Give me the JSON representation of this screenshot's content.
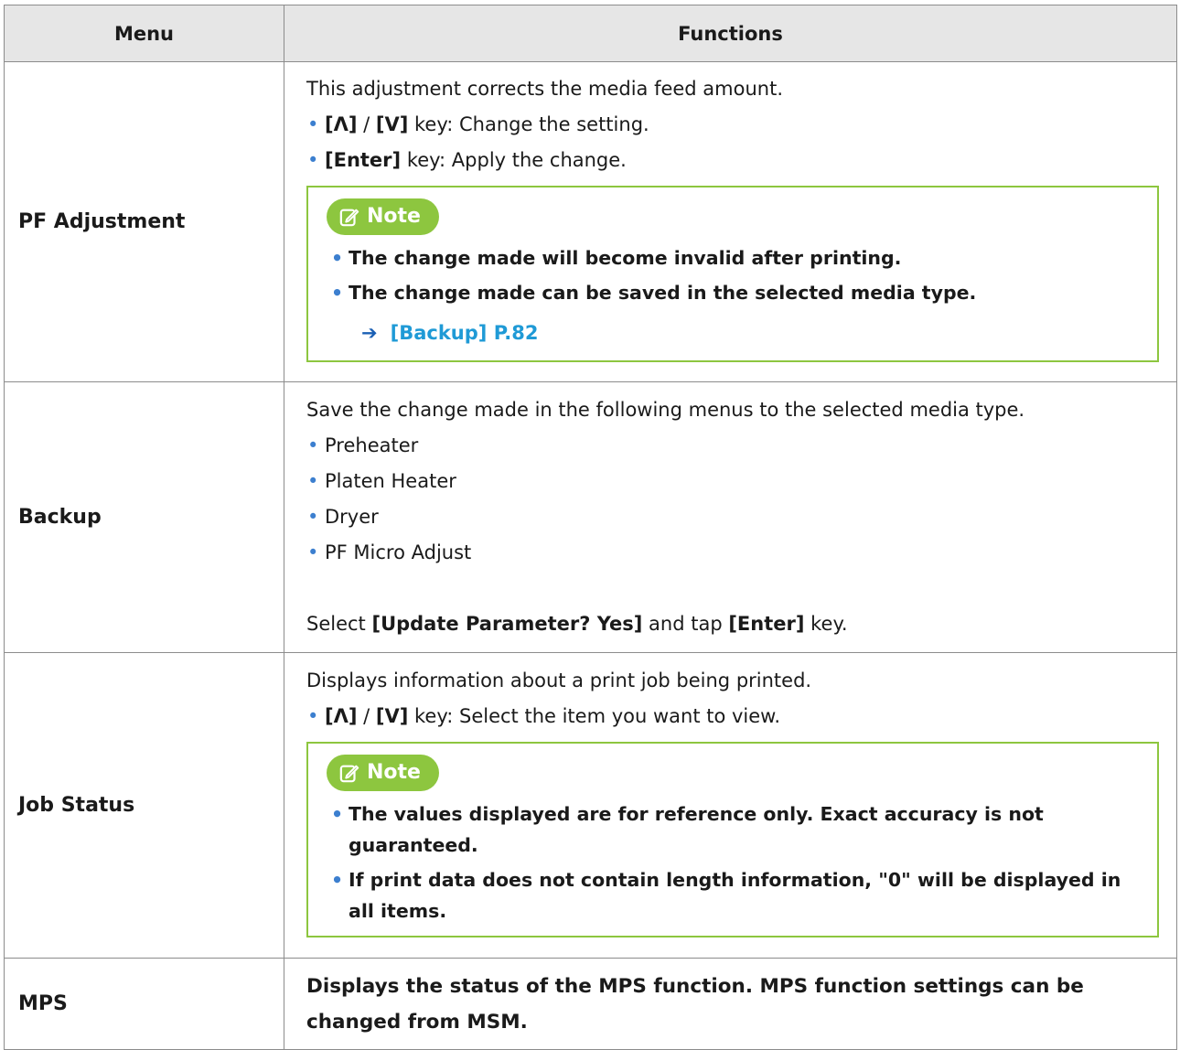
{
  "table": {
    "headers": {
      "menu": "Menu",
      "functions": "Functions"
    },
    "rows": [
      {
        "menu": "PF Adjustment",
        "intro": "This adjustment corrects the media feed amount.",
        "items": [
          {
            "key": "[Λ]",
            "sep": " / ",
            "key2": "[V]",
            "rest": " key: Change the setting."
          },
          {
            "key": "[Enter]",
            "rest": " key: Apply the change."
          }
        ],
        "note": {
          "label": "Note",
          "items": [
            "The change made will become invalid after printing.",
            "The change made can be saved in the selected media type."
          ],
          "link": "[Backup] P.82"
        }
      },
      {
        "menu": "Backup",
        "intro": "Save the change made in the following menus to the selected media type.",
        "items": [
          "Preheater",
          "Platen Heater",
          "Dryer",
          "PF Micro Adjust"
        ],
        "footer_pre": "Select ",
        "footer_b1": "[Update Parameter? Yes]",
        "footer_mid": " and tap ",
        "footer_b2": "[Enter]",
        "footer_post": " key."
      },
      {
        "menu": "Job Status",
        "intro": "Displays information about a print job being printed.",
        "items": [
          {
            "key": "[Λ]",
            "sep": " / ",
            "key2": "[V]",
            "rest": " key: Select the item you want to view."
          }
        ],
        "note": {
          "label": "Note",
          "items": [
            "The values displayed are for reference only. Exact accuracy is not guaranteed.",
            "If print data does not contain length information, \"0\" will be displayed in all items."
          ]
        }
      },
      {
        "menu": "MPS",
        "text": "Displays the status of the MPS function. MPS function settings can be changed from MSM."
      }
    ]
  },
  "colors": {
    "note_green": "#8dc63f",
    "link_blue": "#1f9ad6",
    "bullet_blue": "#3c7fcf",
    "header_gray": "#e6e6e6"
  },
  "icons": {
    "note": "edit-note-icon",
    "link_arrow": "right-arrow-icon"
  }
}
